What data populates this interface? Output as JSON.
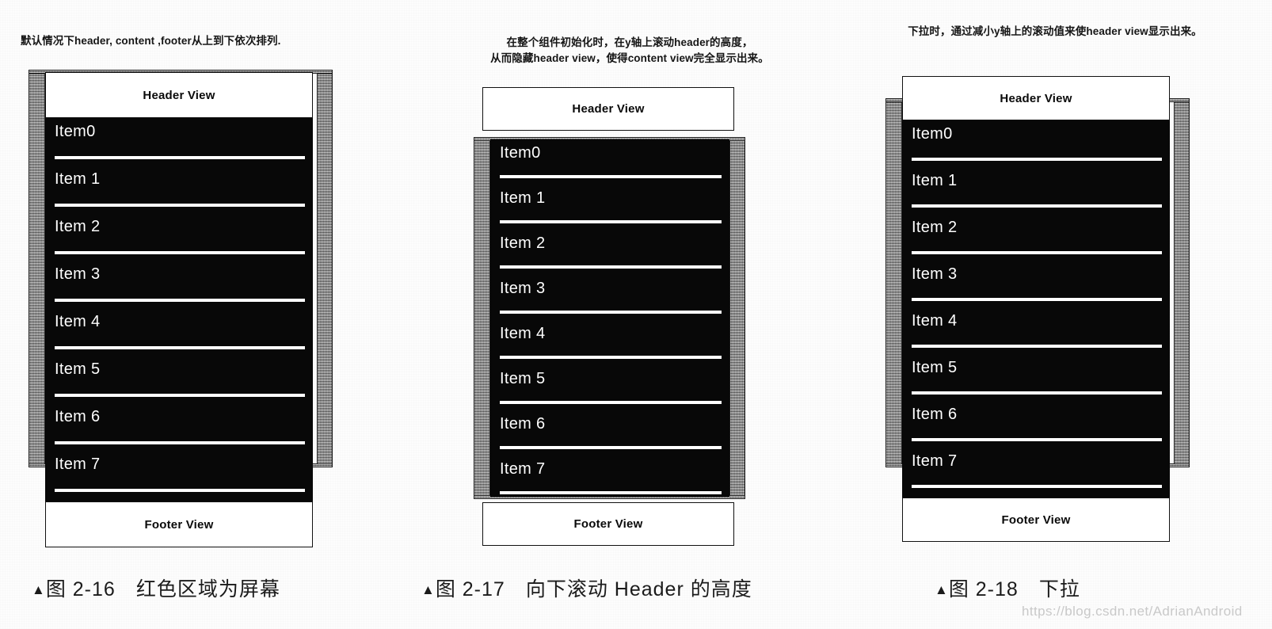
{
  "meta": {
    "watermark": "https://blog.csdn.net/AdrianAndroid",
    "colors": {
      "screen_frame_gray": "#8d8d8d",
      "content_black": "#080808",
      "bar_white": "#ffffff",
      "ink": "#111111",
      "paper": "#fdfdfd"
    }
  },
  "panels": [
    {
      "id": "panel-1",
      "note": "默认情况下header, content ,footer从上到下依次排列.",
      "header_label": "Header View",
      "footer_label": "Footer View",
      "items": [
        "Item0",
        "Item 1",
        "Item 2",
        "Item 3",
        "Item 4",
        "Item 5",
        "Item 6",
        "Item 7"
      ],
      "caption": {
        "marker": "▲",
        "figure_number": "图 2-16",
        "text": "红色区域为屏幕"
      }
    },
    {
      "id": "panel-2",
      "note": "在整个组件初始化时，在y轴上滚动header的高度，\n从而隐藏header view，使得content view完全显示出来。",
      "header_label": "Header View",
      "footer_label": "Footer View",
      "items": [
        "Item0",
        "Item 1",
        "Item 2",
        "Item 3",
        "Item 4",
        "Item 5",
        "Item 6",
        "Item 7"
      ],
      "caption": {
        "marker": "▲",
        "figure_number": "图 2-17",
        "text": "向下滚动 Header 的高度"
      }
    },
    {
      "id": "panel-3",
      "note": "下拉时，通过减小y轴上的滚动值来使header view显示出来。",
      "header_label": "Header View",
      "footer_label": "Footer View",
      "items": [
        "Item0",
        "Item 1",
        "Item 2",
        "Item 3",
        "Item 4",
        "Item 5",
        "Item 6",
        "Item 7"
      ],
      "caption": {
        "marker": "▲",
        "figure_number": "图 2-18",
        "text": "下拉"
      }
    }
  ]
}
